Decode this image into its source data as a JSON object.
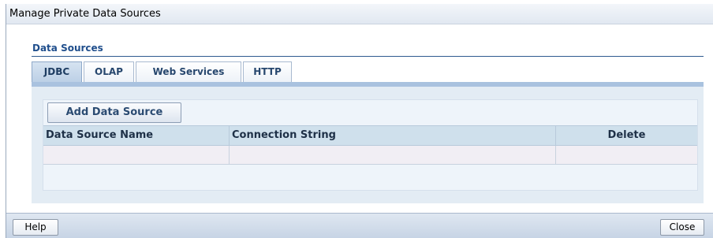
{
  "dialog": {
    "title": "Manage Private Data Sources"
  },
  "section": {
    "label": "Data Sources"
  },
  "tabs": [
    {
      "label": "JDBC",
      "active": true
    },
    {
      "label": "OLAP",
      "active": false
    },
    {
      "label": "Web Services",
      "active": false
    },
    {
      "label": "HTTP",
      "active": false
    }
  ],
  "toolbar": {
    "add_label": "Add Data Source"
  },
  "table": {
    "columns": [
      "Data Source Name",
      "Connection String",
      "Delete"
    ],
    "rows": [
      [
        "",
        "",
        ""
      ]
    ]
  },
  "footer": {
    "help_label": "Help",
    "close_label": "Close"
  },
  "colors": {
    "title_bar": "#e1e8f1",
    "section_label": "#1f4e8c",
    "tab_text": "#27476e",
    "panel_bg": "#e3ecf4",
    "header_bg": "#cfe0ec"
  }
}
